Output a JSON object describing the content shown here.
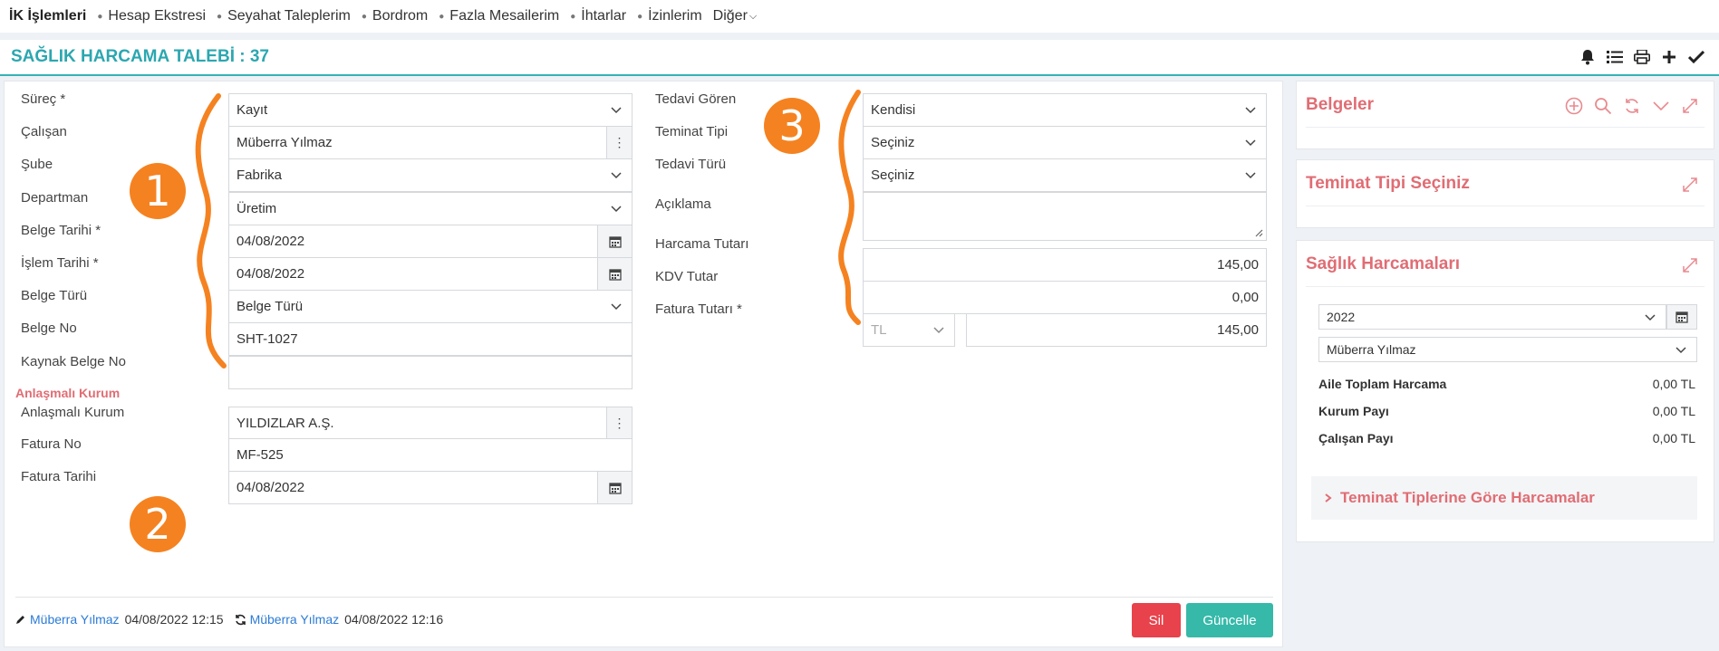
{
  "nav": {
    "items": [
      "İK İşlemleri",
      "Hesap Ekstresi",
      "Seyahat Taleplerim",
      "Bordrom",
      "Fazla Mesailerim",
      "İhtarlar",
      "İzinlerim",
      "Diğer"
    ]
  },
  "header": {
    "title": "SAĞLIK HARCAMA TALEBİ : 37",
    "tools": [
      "bell-icon",
      "list-icon",
      "print-icon",
      "plus-icon",
      "check-icon"
    ]
  },
  "form": {
    "left": [
      {
        "label": "Süreç *",
        "value": "Kayıt",
        "kind": "select"
      },
      {
        "label": "Çalışan",
        "value": "Müberra Yılmaz",
        "kind": "lookup"
      },
      {
        "label": "Şube",
        "value": "Fabrika",
        "kind": "select"
      },
      {
        "label": "Departman",
        "value": "Üretim",
        "kind": "select"
      },
      {
        "label": "Belge Tarihi *",
        "value": "04/08/2022",
        "kind": "date"
      },
      {
        "label": "İşlem Tarihi *",
        "value": "04/08/2022",
        "kind": "date"
      },
      {
        "label": "Belge Türü",
        "value": "Belge Türü",
        "kind": "select"
      },
      {
        "label": "Belge No",
        "value": "SHT-1027",
        "kind": "text"
      },
      {
        "label": "Kaynak Belge No",
        "value": "",
        "kind": "text"
      }
    ],
    "section_title": "Anlaşmalı Kurum",
    "section": [
      {
        "label": "Anlaşmalı Kurum",
        "value": "YILDIZLAR A.Ş.",
        "kind": "lookup"
      },
      {
        "label": "Fatura No",
        "value": "MF-525",
        "kind": "text"
      },
      {
        "label": "Fatura Tarihi",
        "value": "04/08/2022",
        "kind": "date"
      }
    ],
    "right": {
      "tedavi_goren": {
        "label": "Tedavi Gören",
        "value": "Kendisi"
      },
      "teminat_tipi": {
        "label": "Teminat Tipi",
        "value": "Seçiniz"
      },
      "tedavi_turu": {
        "label": "Tedavi Türü",
        "value": "Seçiniz"
      },
      "aciklama": {
        "label": "Açıklama",
        "value": ""
      },
      "harcama_tutari": {
        "label": "Harcama Tutarı",
        "value": "145,00"
      },
      "kdv_tutar": {
        "label": "KDV Tutar",
        "value": "0,00"
      },
      "fatura_tutari": {
        "label": "Fatura Tutarı *",
        "currency": "TL",
        "value": "145,00"
      }
    }
  },
  "annotations": {
    "badge1": "1",
    "badge2": "2",
    "badge3": "3",
    "color": "#f58220"
  },
  "footer": {
    "created_by": "Müberra Yılmaz",
    "created_at": "04/08/2022 12:15",
    "updated_by": "Müberra Yılmaz",
    "updated_at": "04/08/2022 12:16",
    "delete_label": "Sil",
    "update_label": "Güncelle"
  },
  "side": {
    "belgeler": {
      "title": "Belgeler"
    },
    "teminat": {
      "title": "Teminat Tipi Seçiniz"
    },
    "saglik": {
      "title": "Sağlık Harcamaları",
      "year": "2022",
      "person": "Müberra Yılmaz",
      "rows": [
        {
          "label": "Aile Toplam Harcama",
          "value": "0,00 TL"
        },
        {
          "label": "Kurum Payı",
          "value": "0,00 TL"
        },
        {
          "label": "Çalışan Payı",
          "value": "0,00 TL"
        }
      ],
      "accordion": "Teminat Tiplerine Göre Harcamalar"
    }
  },
  "colors": {
    "accent": "#2ba7b0",
    "section": "#e06d74",
    "delete": "#e8424c",
    "update": "#36b9a9"
  }
}
